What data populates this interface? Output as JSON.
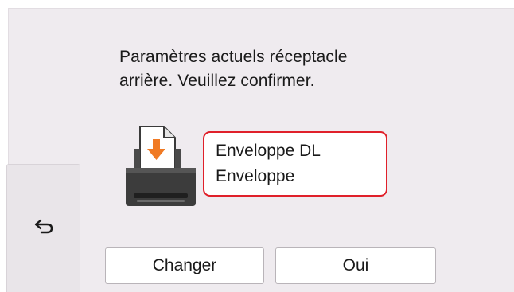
{
  "message": {
    "line1": "Paramètres actuels réceptacle",
    "line2": "arrière. Veuillez confirmer."
  },
  "paper_settings": {
    "size": "Enveloppe DL",
    "type": "Enveloppe"
  },
  "buttons": {
    "change_label": "Changer",
    "ok_label": "Oui"
  },
  "icons": {
    "printer": "printer-rear-tray-icon",
    "back": "back-arrow-icon"
  },
  "colors": {
    "highlight_border": "#e0202a",
    "feed_arrow": "#f07a24",
    "background": "#efebef"
  }
}
